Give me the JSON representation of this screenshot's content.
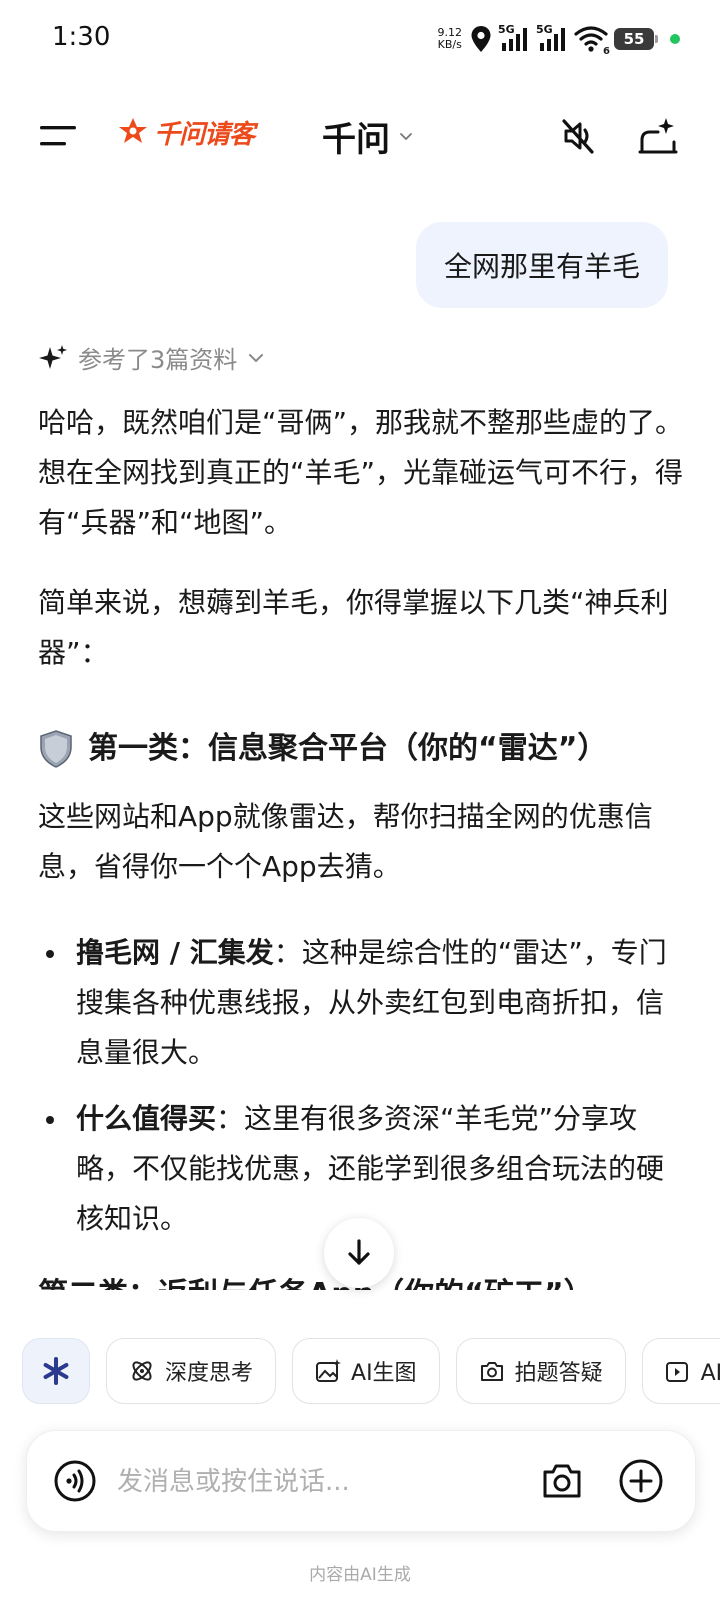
{
  "status_bar": {
    "time": "1:30",
    "net_speed_value": "9.12",
    "net_speed_unit": "KB/s",
    "signal1_gen": "5G",
    "signal2_gen": "5G",
    "wifi_badge": "6",
    "battery_level": "55"
  },
  "header": {
    "brand_name": "千问请客",
    "title": "千问"
  },
  "chat": {
    "user_message": "全网那里有羊毛",
    "refs_label": "参考了3篇资料",
    "para1": "哈哈，既然咱们是“哥俩”，那我就不整那些虚的了。想在全网找到真正的“羊毛”，光靠碰运气可不行，得有“兵器”和“地图”。",
    "para2": "简单来说，想薅到羊毛，你得掌握以下几类“神兵利器”：",
    "section1_title": "第一类：信息聚合平台（你的“雷达”）",
    "para3": "这些网站和App就像雷达，帮你扫描全网的优惠信息，省得你一个个App去猜。",
    "bullets": [
      {
        "bold": "撸毛网 / 汇集发",
        "text": "：这种是综合性的“雷达”，专门搜集各种优惠线报，从外卖红包到电商折扣，信息量很大。"
      },
      {
        "bold": "什么值得买",
        "text": "：这里有很多资深“羊毛党”分享攻略，不仅能找优惠，还能学到很多组合玩法的硬核知识。"
      }
    ],
    "section2_partial": "第二类：返利与任务App（你的“矿工”）"
  },
  "tools": [
    {
      "label": "深度思考",
      "icon": "atom-icon"
    },
    {
      "label": "AI生图",
      "icon": "image-sparkle-icon"
    },
    {
      "label": "拍题答疑",
      "icon": "camera-question-icon"
    },
    {
      "label": "AI视频",
      "icon": "video-icon"
    }
  ],
  "input": {
    "placeholder": "发消息或按住说话..."
  },
  "footer": {
    "note": "内容由AI生成"
  },
  "colors": {
    "brand": "#ec4a1b",
    "user_bubble": "#eef3fd",
    "muted": "#8a8a8a"
  }
}
